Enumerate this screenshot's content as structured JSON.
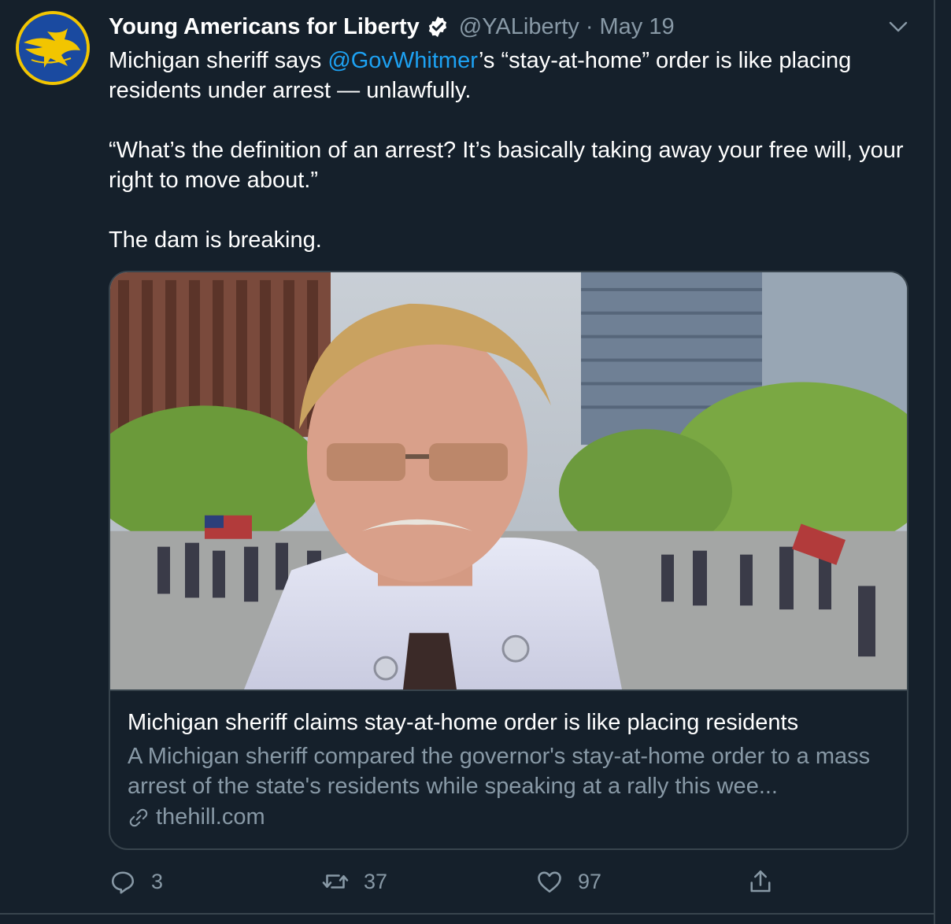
{
  "tweet": {
    "author_name": "Young Americans for Liberty",
    "handle": "@YALiberty",
    "separator": "·",
    "date": "May 19",
    "text_part1": "Michigan sheriff says ",
    "mention": "@GovWhitmer",
    "text_part2": "’s “stay-at-home” order is like placing residents under arrest — unlawfully.",
    "quote": "“What’s the definition of an arrest? It’s basically taking away your free will, your right to move about.”",
    "closing": "The dam is breaking."
  },
  "card": {
    "title": "Michigan sheriff claims stay-at-home order is like placing residents",
    "description": "A Michigan sheriff compared the governor's stay-at-home order to a mass arrest of the state's residents while speaking at a rally this wee...",
    "domain": "thehill.com"
  },
  "actions": {
    "reply_count": "3",
    "retweet_count": "37",
    "like_count": "97"
  },
  "colors": {
    "background": "#15202b",
    "secondary_text": "#8899a6",
    "accent": "#1da1f2",
    "border": "#38444d"
  },
  "icons": [
    "verified-badge-icon",
    "chevron-down-icon",
    "link-icon",
    "reply-icon",
    "retweet-icon",
    "like-icon",
    "share-icon"
  ]
}
